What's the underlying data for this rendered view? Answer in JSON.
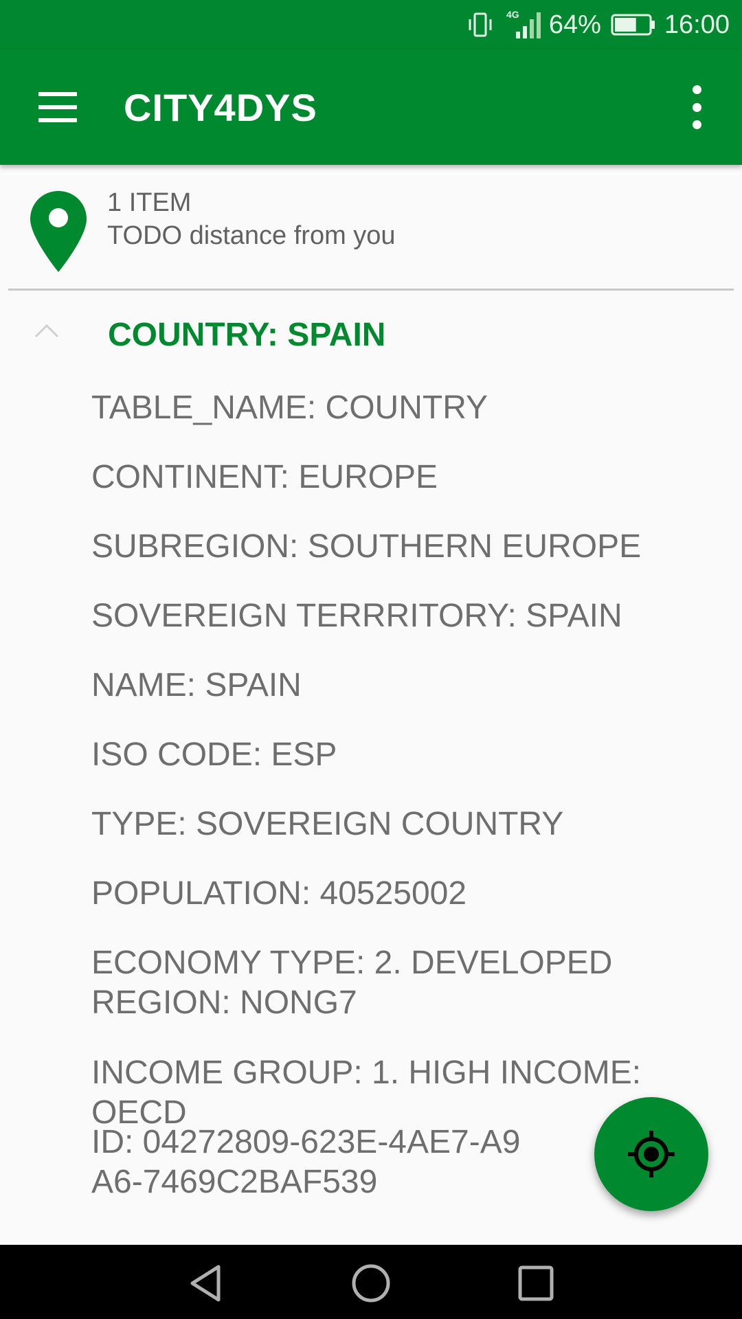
{
  "status_bar": {
    "network": "4G",
    "battery": "64%",
    "time": "16:00",
    "battery_level": 0.64
  },
  "app_bar": {
    "title": "CITY4DYS",
    "menu_icon": "hamburger-menu-icon",
    "overflow_icon": "more-vert-icon"
  },
  "summary": {
    "icon": "map-pin-icon",
    "count": "1 ITEM",
    "distance": "TODO distance from you"
  },
  "group": {
    "title": "COUNTRY: SPAIN",
    "expanded_icon": "chevron-up-icon",
    "items": [
      "TABLE_NAME: COUNTRY",
      "CONTINENT: EUROPE",
      "SUBREGION: SOUTHERN EUROPE",
      "SOVEREIGN TERRRITORY: SPAIN",
      "NAME: SPAIN",
      "ISO CODE: ESP",
      "TYPE: SOVEREIGN COUNTRY",
      "POPULATION: 40525002",
      "ECONOMY TYPE: 2. DEVELOPED REGION: NONG7",
      "INCOME GROUP: 1. HIGH INCOME: OECD",
      "ID: 04272809-623E-4AE7-A9A6-7469C2BAF539"
    ]
  },
  "fab": {
    "icon": "my-location-icon"
  },
  "nav_bar": {
    "icons": [
      "back-icon",
      "home-icon",
      "recents-icon"
    ]
  },
  "colors": {
    "primary": "#00892e",
    "status_bar": "#00872f",
    "text": "#6e6e6e",
    "background": "#fafafa"
  }
}
